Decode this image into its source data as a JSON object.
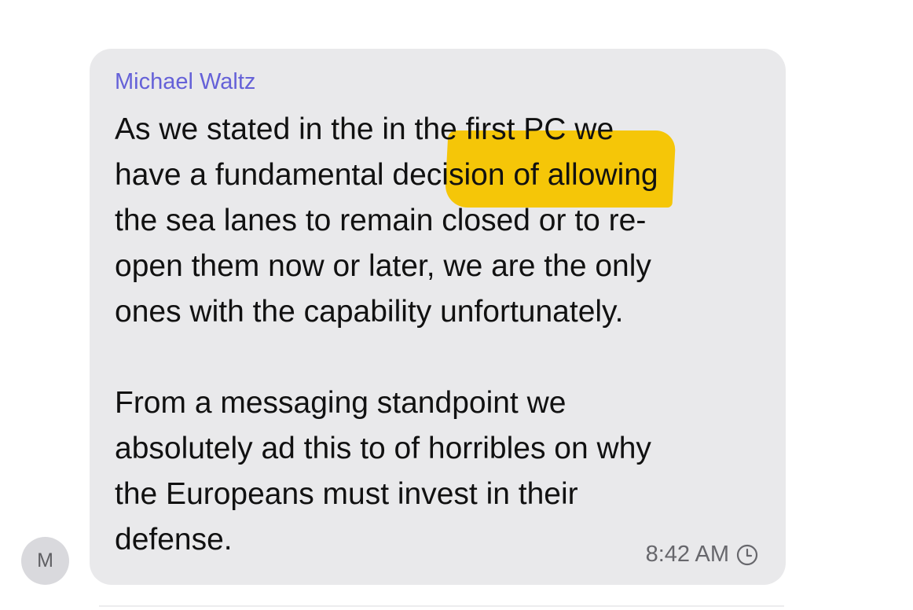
{
  "message": {
    "avatar_initial": "M",
    "sender_name": "Michael Waltz",
    "lines": [
      "As we stated in the ",
      "in the first PC",
      " we",
      "have a fundamental decision of allowing",
      "the sea lanes to remain closed or to re-",
      "open them now or later, we are the only",
      "ones with the capability unfortunately.",
      "From a messaging standpoint we",
      "absolutely ad this to of horribles on why",
      "the Europeans must invest in their",
      "defense."
    ],
    "highlighted_text": "in the first PC",
    "timestamp": "8:42 AM",
    "status_icon": "clock-icon"
  },
  "colors": {
    "bubble": "#e9e9eb",
    "sender": "#6561d8",
    "highlight": "#f5c400",
    "timestamp": "#67676c",
    "avatar": "#d9d9dd"
  }
}
